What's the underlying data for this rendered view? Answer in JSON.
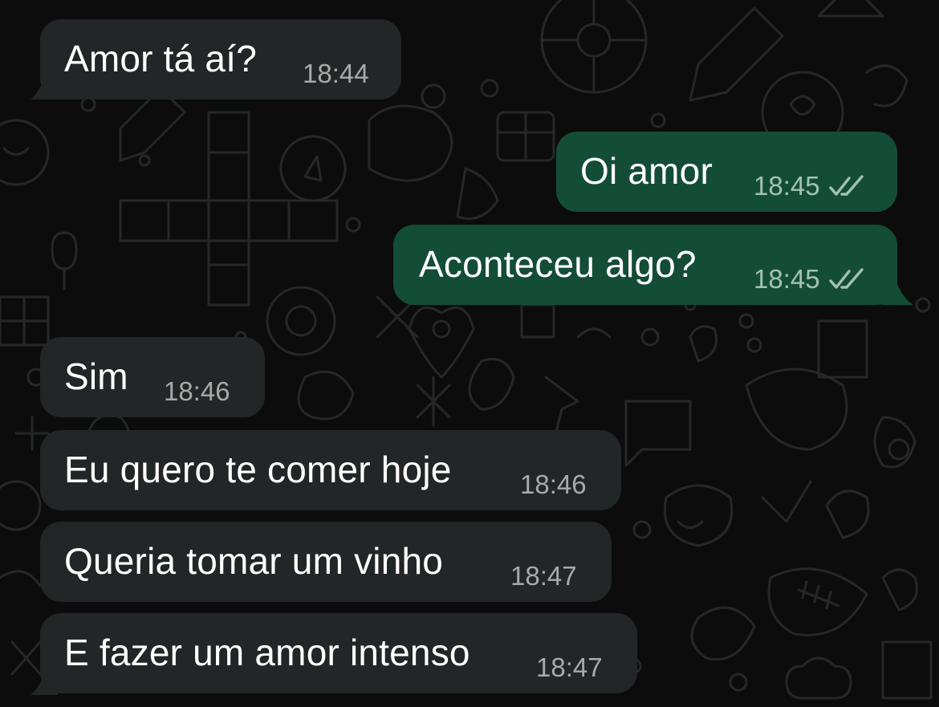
{
  "conversation": {
    "messages": [
      {
        "direction": "incoming",
        "text": "Amor tá aí?",
        "time": "18:44"
      },
      {
        "direction": "outgoing",
        "text": "Oi amor",
        "time": "18:45",
        "status_icon": "double-check-icon"
      },
      {
        "direction": "outgoing",
        "text": "Aconteceu algo?",
        "time": "18:45",
        "status_icon": "double-check-icon"
      },
      {
        "direction": "incoming",
        "text": "Sim",
        "time": "18:46"
      },
      {
        "direction": "incoming",
        "text": "Eu quero te comer hoje",
        "time": "18:46"
      },
      {
        "direction": "incoming",
        "text": "Queria tomar um vinho",
        "time": "18:47"
      },
      {
        "direction": "incoming",
        "text": "E fazer um amor intenso",
        "time": "18:47"
      }
    ]
  },
  "colors": {
    "background": "#0c0c0c",
    "incoming_bubble": "#232626",
    "outgoing_bubble": "#144d37",
    "timestamp": "#a6aba9",
    "read_ticks": "#a3c2b4"
  }
}
